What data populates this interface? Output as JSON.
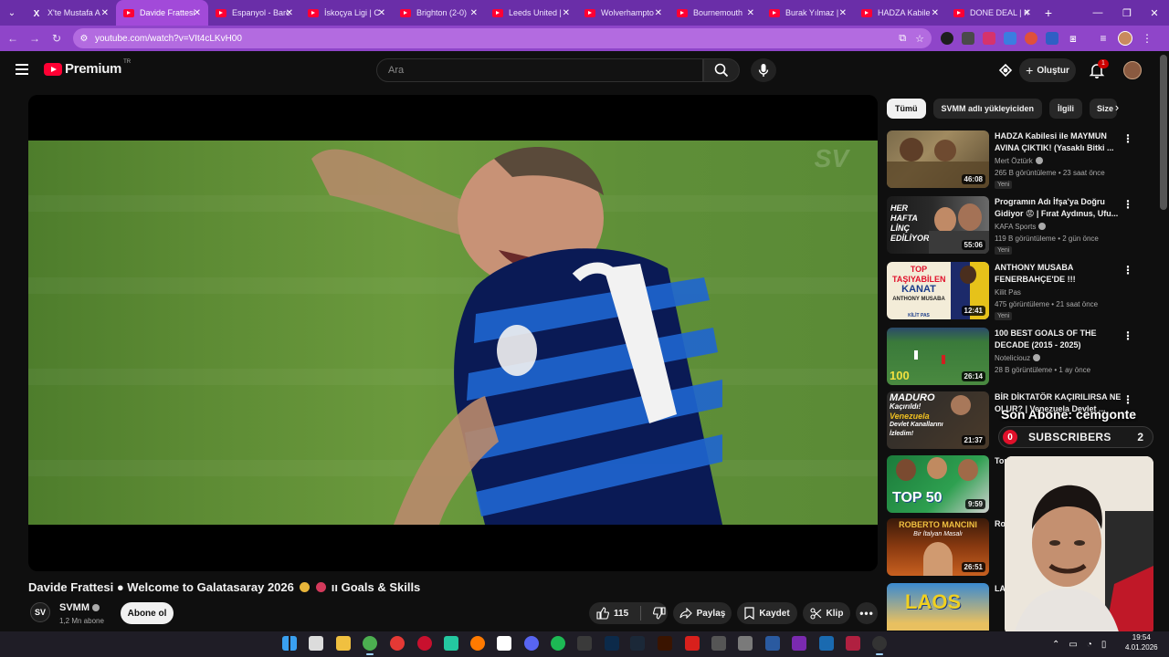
{
  "browser": {
    "tabs": [
      {
        "label": "X'te Mustafa A",
        "icon": "x-icon",
        "active": false
      },
      {
        "label": "Davide Frattesi",
        "icon": "youtube-icon",
        "active": true
      },
      {
        "label": "Espanyol - Barc",
        "icon": "youtube-icon",
        "active": false
      },
      {
        "label": "İskoçya Ligi | C",
        "icon": "youtube-icon",
        "active": false
      },
      {
        "label": "Brighton (2-0)",
        "icon": "youtube-icon",
        "active": false
      },
      {
        "label": "Leeds United |",
        "icon": "youtube-icon",
        "active": false
      },
      {
        "label": "Wolverhampto",
        "icon": "youtube-icon",
        "active": false
      },
      {
        "label": "Bournemouth",
        "icon": "youtube-icon",
        "active": false
      },
      {
        "label": "Burak Yılmaz |",
        "icon": "youtube-icon",
        "active": false
      },
      {
        "label": "HADZA Kabile",
        "icon": "youtube-icon",
        "active": false
      },
      {
        "label": "DONE DEAL | K",
        "icon": "youtube-icon",
        "active": false
      }
    ],
    "url": "youtube.com/watch?v=VIt4cLKvH00",
    "colors": {
      "tabbar": "#6a2ea8",
      "active_tab": "#a24ad9",
      "toolbar": "#8f45c9"
    }
  },
  "header": {
    "logo_text": "Premium",
    "country_code": "TR",
    "search_placeholder": "Ara",
    "create_label": "Oluştur",
    "notification_count": "1"
  },
  "video": {
    "title_part1": "Davide Frattesi ● Welcome to Galatasaray 2026",
    "title_part2": "ıı Goals & Skills",
    "channel": "SVMM",
    "subscribers": "1,2 Mn abone",
    "subscribe_label": "Abone ol",
    "likes": "115",
    "share_label": "Paylaş",
    "save_label": "Kaydet",
    "clip_label": "Klip",
    "watermark": "SV"
  },
  "sidebar": {
    "chips": [
      "Tümü",
      "SVMM adlı yükleyiciden",
      "İlgili",
      "Size"
    ],
    "recommendations": [
      {
        "title": "HADZA Kabilesi ile MAYMUN AVINA ÇIKTIK! (Yasaklı Bitki ...",
        "channel": "Mert Öztürk",
        "meta": "265 B görüntüleme • 23 saat önce",
        "duration": "46:08",
        "new": "Yeni"
      },
      {
        "title": "Programın Adı İfşa'ya Doğru Gidiyor 😡 | Fırat Aydınus, Ufu...",
        "channel": "KAFA Sports",
        "meta": "119 B görüntüleme • 2 gün önce",
        "duration": "55:06",
        "new": "Yeni"
      },
      {
        "title": "ANTHONY MUSABA FENERBAHÇE'DE !!!",
        "channel": "Kilit Pas",
        "meta": "475 görüntüleme • 21 saat önce",
        "duration": "12:41",
        "new": "Yeni"
      },
      {
        "title": "100 BEST GOALS OF THE DECADE (2015 - 2025)",
        "channel": "Noteliciouz",
        "meta": "28 B görüntüleme • 1 ay önce",
        "duration": "26:14",
        "new": ""
      },
      {
        "title": "BİR DİKTATÖR KAÇIRILIRSA NE OLUR? | Venezuela Devlet ...",
        "channel": "",
        "meta": "",
        "duration": "21:37",
        "new": ""
      },
      {
        "title": "Top",
        "channel": "",
        "meta": "",
        "duration": "9:59",
        "new": ""
      },
      {
        "title": "Ro",
        "channel": "",
        "meta": "",
        "duration": "26:51",
        "new": ""
      },
      {
        "title": "LA",
        "channel": "",
        "meta": "",
        "duration": "",
        "new": ""
      }
    ],
    "thumb_texts": {
      "t2": "HER HAFTA LİNÇ EDİLİYORUM",
      "t3a": "TOP TAŞIYABİLEN",
      "t3b": "KANAT",
      "t3c": "ANTHONY MUSABA",
      "t3d": "KİLİT PAS",
      "t4": "100",
      "t5a": "MADURO",
      "t5b": "Kaçırıldı!",
      "t5c": "Venezuela",
      "t5d": "Devlet Kanallarını İzledim!",
      "t6": "TOP 50",
      "t7a": "ROBERTO MANCINI",
      "t7b": "Bir İtalyan Masalı",
      "t8": "LAOS"
    }
  },
  "overlay": {
    "last_sub_text": "Son Abone: cemgonte",
    "counter_left": "0",
    "counter_label": "SUBSCRIBERS",
    "counter_right": "2"
  },
  "taskbar": {
    "time": "19:54",
    "date": "4.01.2026"
  }
}
